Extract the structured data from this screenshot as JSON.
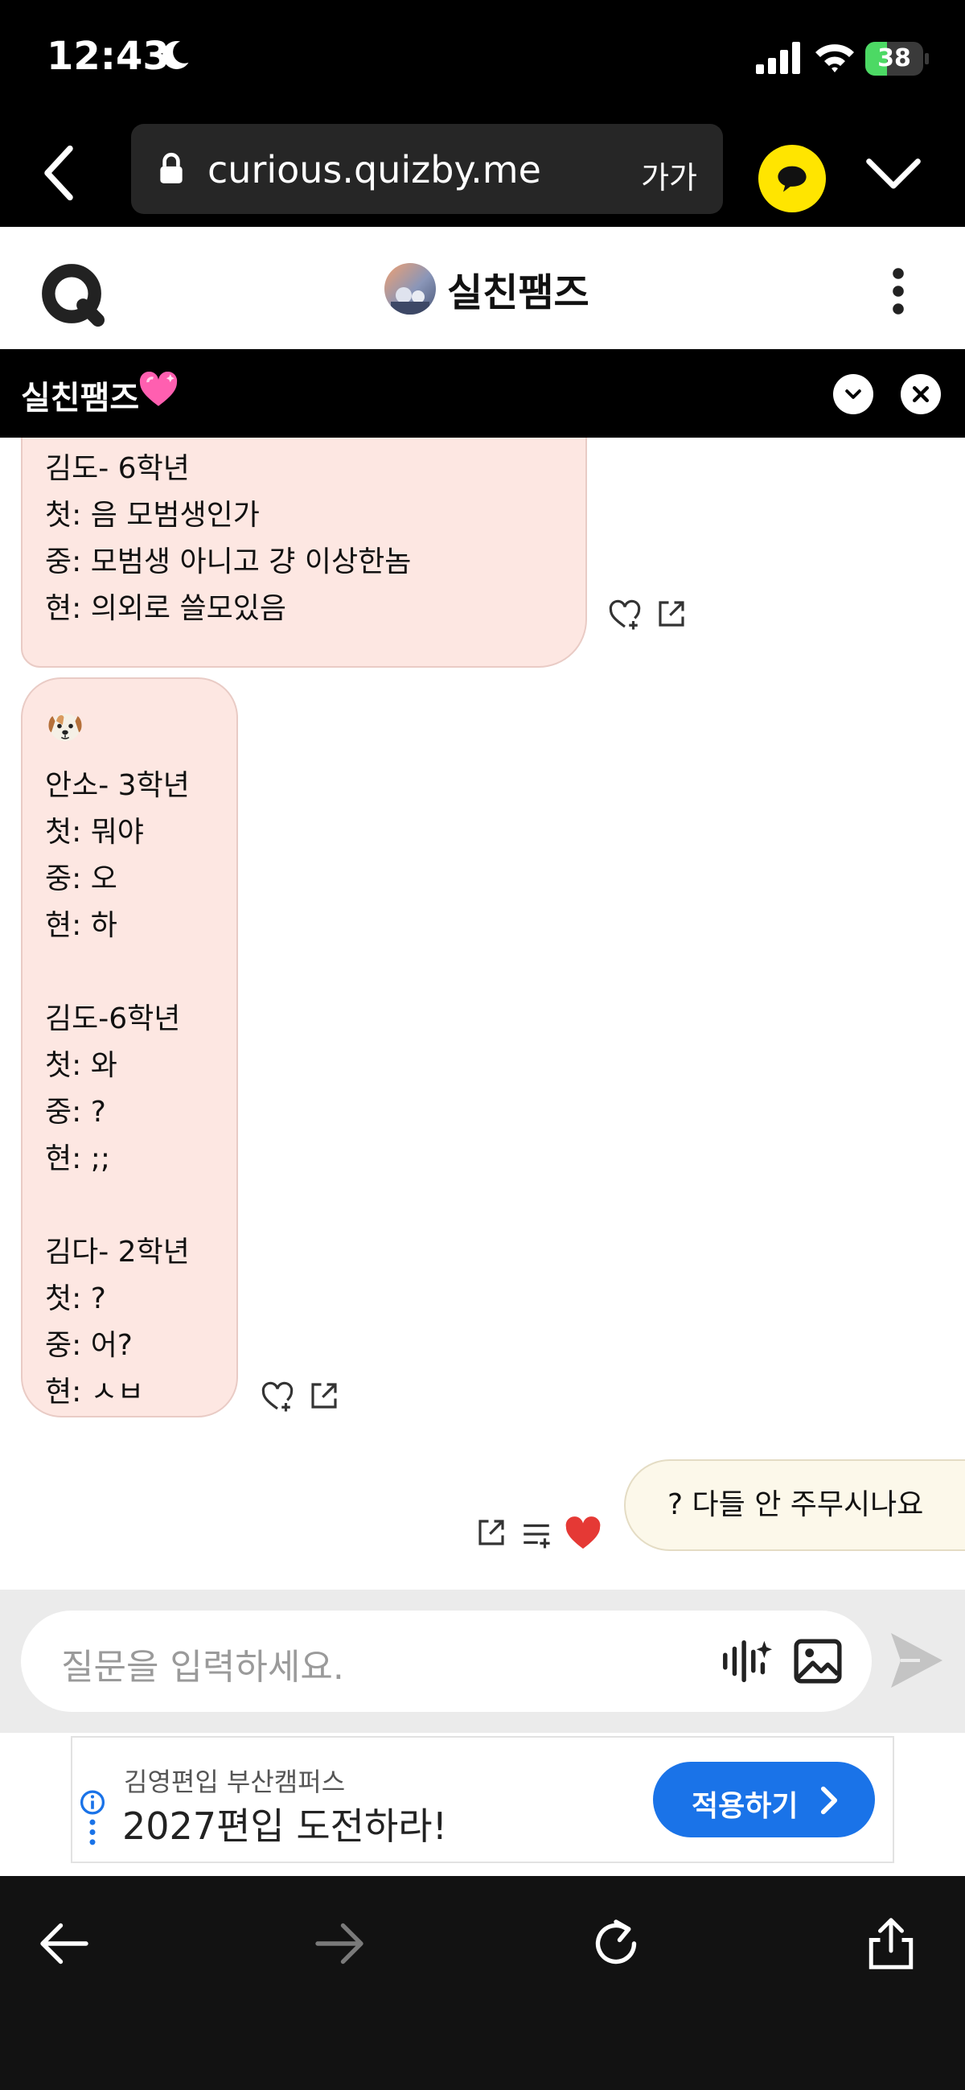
{
  "status_bar": {
    "time": "12:43",
    "battery_percent": "38",
    "battery_level": 0.38
  },
  "browser": {
    "url": "curious.quizby.me",
    "font_size_label": "가가"
  },
  "header": {
    "title": "실친팸즈"
  },
  "pinned": {
    "text": "실친팸즈"
  },
  "messages": [
    {
      "lines": [
        "김도- 6학년",
        "첫: 음 모범생인가",
        "중: 모범생 아니고 걍 이상한놈",
        "현: 의외로 쓸모있음"
      ]
    },
    {
      "lines": [
        "안소- 3학년",
        "첫: 뭐야",
        "중: 오",
        "현: 하",
        "",
        "김도-6학년",
        "첫: 와",
        "중: ?",
        "현: ;;",
        "",
        "김다- 2학년",
        "첫: ?",
        "중: 어?",
        "현: ㅅㅂ"
      ]
    }
  ],
  "my_message": {
    "text": "? 다들 안 주무시나요"
  },
  "input": {
    "placeholder": "질문을 입력하세요."
  },
  "ad": {
    "advertiser": "김영편입 부산캠퍼스",
    "headline": "2027편입 도전하라!",
    "cta": "적용하기"
  },
  "colors": {
    "friend_bubble": "#fde7e2",
    "my_bubble": "#fcf8ea",
    "kakao_yellow": "#ffe500",
    "ad_button": "#1a73e8",
    "like_heart": "#e53935"
  }
}
